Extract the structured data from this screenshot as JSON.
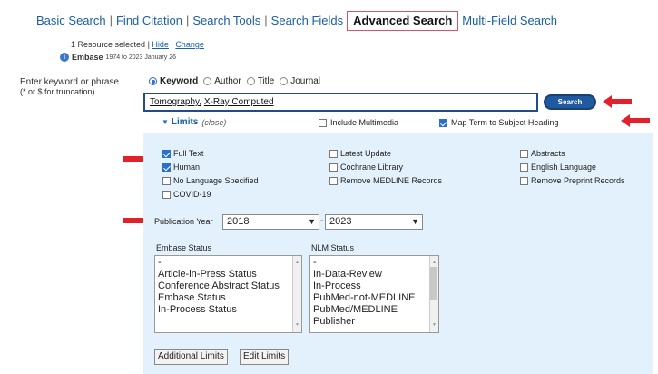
{
  "tabs": {
    "basic": "Basic Search",
    "citation": "Find Citation",
    "tools": "Search Tools",
    "fields": "Search Fields",
    "advanced": "Advanced Search",
    "multifield": "Multi-Field Search",
    "separator": "|"
  },
  "resource": {
    "selected": "1 Resource selected",
    "sep": "|",
    "hide": "Hide",
    "change": "Change",
    "db_name": "Embase",
    "db_range": "1974 to 2023 January 26"
  },
  "keyword_label": {
    "line1": "Enter keyword or phrase",
    "line2": "(* or $ for truncation)"
  },
  "search_modes": {
    "keyword": "Keyword",
    "author": "Author",
    "title": "Title",
    "journal": "Journal",
    "selected": "Keyword"
  },
  "search": {
    "query_part1": "Tomography,",
    "query_part2": "X-Ray Computed",
    "button": "Search"
  },
  "limits": {
    "label": "Limits",
    "close": "(close)",
    "include_multimedia": "Include Multimedia",
    "include_multimedia_checked": false,
    "map_term": "Map Term to Subject Heading",
    "map_term_checked": true,
    "options": {
      "full_text": "Full Text",
      "human": "Human",
      "no_language": "No Language Specified",
      "covid": "COVID-19",
      "latest_update": "Latest Update",
      "cochrane": "Cochrane Library",
      "remove_medline": "Remove MEDLINE Records",
      "abstracts": "Abstracts",
      "english": "English Language",
      "remove_preprint": "Remove Preprint Records"
    },
    "checked": [
      "full_text",
      "human"
    ]
  },
  "publication_year": {
    "label": "Publication Year",
    "from": "2018",
    "separator": "-",
    "to": "2023"
  },
  "embase_status": {
    "title": "Embase Status",
    "items": [
      "-",
      "Article-in-Press Status",
      "Conference Abstract Status",
      "Embase Status",
      "In-Process Status"
    ]
  },
  "nlm_status": {
    "title": "NLM Status",
    "items": [
      "-",
      "In-Data-Review",
      "In-Process",
      "PubMed-not-MEDLINE",
      "PubMed/MEDLINE",
      "Publisher"
    ]
  },
  "buttons": {
    "additional_limits": "Additional Limits",
    "edit_limits": "Edit Limits"
  },
  "colors": {
    "link": "#1a5ea8",
    "panel": "#e2f1fb",
    "arrow": "#e4202a",
    "active_tab_border": "#d9536b",
    "search_button": "#1f5aa0"
  }
}
